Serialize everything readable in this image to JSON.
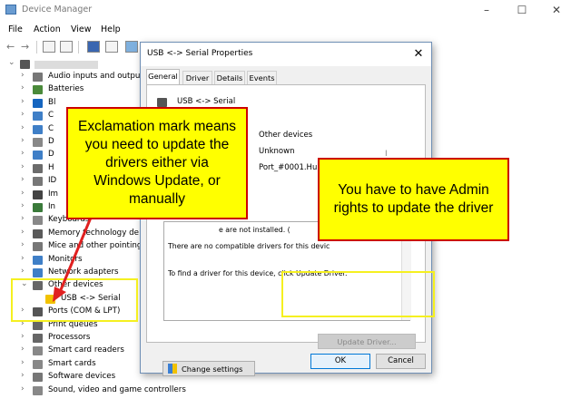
{
  "window": {
    "title": "Device Manager",
    "minimize": "–",
    "maximize": "☐",
    "close": "✕"
  },
  "menu": [
    "File",
    "Action",
    "View",
    "Help"
  ],
  "tree": {
    "root_label": "",
    "items": [
      {
        "label": "Audio inputs and output",
        "expanded": false,
        "icon": "speaker-icon"
      },
      {
        "label": "Batteries",
        "expanded": false,
        "icon": "battery-icon"
      },
      {
        "label": "Bl",
        "expanded": false,
        "icon": "bluetooth-icon"
      },
      {
        "label": "C",
        "expanded": false,
        "icon": "computer-icon"
      },
      {
        "label": "C",
        "expanded": false,
        "icon": "monitor-icon"
      },
      {
        "label": "D",
        "expanded": false,
        "icon": "disk-icon"
      },
      {
        "label": "D",
        "expanded": false,
        "icon": "display-icon"
      },
      {
        "label": "H",
        "expanded": false,
        "icon": "hid-icon"
      },
      {
        "label": "ID",
        "expanded": false,
        "icon": "ide-icon"
      },
      {
        "label": "Im",
        "expanded": false,
        "icon": "camera-icon"
      },
      {
        "label": "In",
        "expanded": false,
        "icon": "chip-icon"
      },
      {
        "label": "Keyboards",
        "expanded": false,
        "icon": "keyboard-icon"
      },
      {
        "label": "Memory technology de",
        "expanded": false,
        "icon": "memory-icon"
      },
      {
        "label": "Mice and other pointing",
        "expanded": false,
        "icon": "mouse-icon"
      },
      {
        "label": "Monitors",
        "expanded": false,
        "icon": "monitor-icon"
      },
      {
        "label": "Network adapters",
        "expanded": false,
        "icon": "network-icon"
      },
      {
        "label": "Other devices",
        "expanded": true,
        "icon": "unknown-device-icon"
      },
      {
        "label": "USB <-> Serial",
        "sub": true,
        "icon": "warning-device-icon"
      },
      {
        "label": "Ports (COM & LPT)",
        "expanded": false,
        "icon": "port-icon"
      },
      {
        "label": "Print queues",
        "expanded": false,
        "icon": "printer-icon"
      },
      {
        "label": "Processors",
        "expanded": false,
        "icon": "processor-icon"
      },
      {
        "label": "Smart card readers",
        "expanded": false,
        "icon": "smartcard-icon"
      },
      {
        "label": "Smart cards",
        "expanded": false,
        "icon": "smartcard-icon"
      },
      {
        "label": "Software devices",
        "expanded": false,
        "icon": "software-icon"
      },
      {
        "label": "Sound, video and game controllers",
        "expanded": false,
        "icon": "sound-icon"
      }
    ]
  },
  "dialog": {
    "title": "USB <-> Serial Properties",
    "close": "✕",
    "tabs": [
      "General",
      "Driver",
      "Details",
      "Events"
    ],
    "active_tab": "General",
    "device_name": "USB <-> Serial",
    "device_type": "Other devices",
    "manufacturer": "Unknown",
    "location": "Port_#0001.Hub_",
    "status_lines": [
      "e are not installed. (",
      "There are no compatible drivers for this devic",
      "To find a driver for this device, click Update Driver."
    ],
    "update_driver": "Update Driver...",
    "change_settings": "Change settings",
    "ok": "OK",
    "cancel": "Cancel"
  },
  "callouts": {
    "exclamation": "Exclamation mark means you need to update the drivers either via Windows Update, or manually",
    "admin": "You have to have Admin rights to update the driver"
  },
  "colors": {
    "callout_fill": "#ffff00",
    "callout_border": "#cc0000",
    "highlight": "#f5f020",
    "arrow": "#e02020"
  }
}
